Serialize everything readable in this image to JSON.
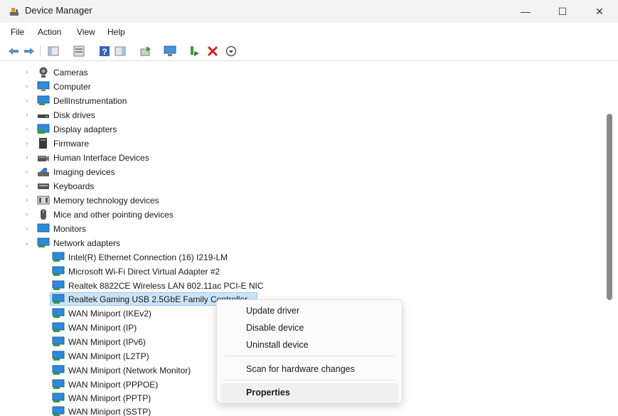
{
  "window": {
    "title": "Device Manager",
    "minimize": "—",
    "maximize": "☐",
    "close": "✕"
  },
  "menu": {
    "file": "File",
    "action": "Action",
    "view": "View",
    "help": "Help"
  },
  "toolbar": [
    "back-icon",
    "forward-icon",
    "show-hide-console-tree-icon",
    "properties-sheet-icon",
    "help-icon",
    "action-pane-icon",
    "update-driver-icon",
    "scan-hardware-icon",
    "enable-device-icon",
    "uninstall-device-icon",
    "download-icon"
  ],
  "tree": {
    "categories": [
      {
        "label": "Cameras",
        "icon": "camera-icon",
        "expanded": false
      },
      {
        "label": "Computer",
        "icon": "computer-icon",
        "expanded": false
      },
      {
        "label": "DellInstrumentation",
        "icon": "monitor-icon",
        "expanded": false
      },
      {
        "label": "Disk drives",
        "icon": "disk-drive-icon",
        "expanded": false
      },
      {
        "label": "Display adapters",
        "icon": "display-adapter-icon",
        "expanded": false
      },
      {
        "label": "Firmware",
        "icon": "firmware-icon",
        "expanded": false
      },
      {
        "label": "Human Interface Devices",
        "icon": "hid-icon",
        "expanded": false
      },
      {
        "label": "Imaging devices",
        "icon": "imaging-icon",
        "expanded": false
      },
      {
        "label": "Keyboards",
        "icon": "keyboard-icon",
        "expanded": false
      },
      {
        "label": "Memory technology devices",
        "icon": "memory-icon",
        "expanded": false
      },
      {
        "label": "Mice and other pointing devices",
        "icon": "mouse-icon",
        "expanded": false
      },
      {
        "label": "Monitors",
        "icon": "monitor-icon",
        "expanded": false
      },
      {
        "label": "Network adapters",
        "icon": "network-icon",
        "expanded": true
      }
    ],
    "network_children": [
      "Intel(R) Ethernet Connection (16) I219-LM",
      "Microsoft Wi-Fi Direct Virtual Adapter #2",
      "Realtek 8822CE Wireless LAN 802.11ac PCI-E NIC",
      "Realtek Gaming USB 2.5GbE Family Controller",
      "WAN Miniport (IKEv2)",
      "WAN Miniport (IP)",
      "WAN Miniport (IPv6)",
      "WAN Miniport (L2TP)",
      "WAN Miniport (Network Monitor)",
      "WAN Miniport (PPPOE)",
      "WAN Miniport (PPTP)",
      "WAN Miniport (SSTP)"
    ],
    "selected": "Realtek Gaming USB 2.5GbE Family Controller"
  },
  "context_menu": {
    "update_driver": "Update driver",
    "disable_device": "Disable device",
    "uninstall_device": "Uninstall device",
    "scan_changes": "Scan for hardware changes",
    "properties": "Properties"
  },
  "colors": {
    "selection": "#cce4f7",
    "network_icon": "#2f8ad8",
    "uninstall_red": "#d41c1c"
  }
}
